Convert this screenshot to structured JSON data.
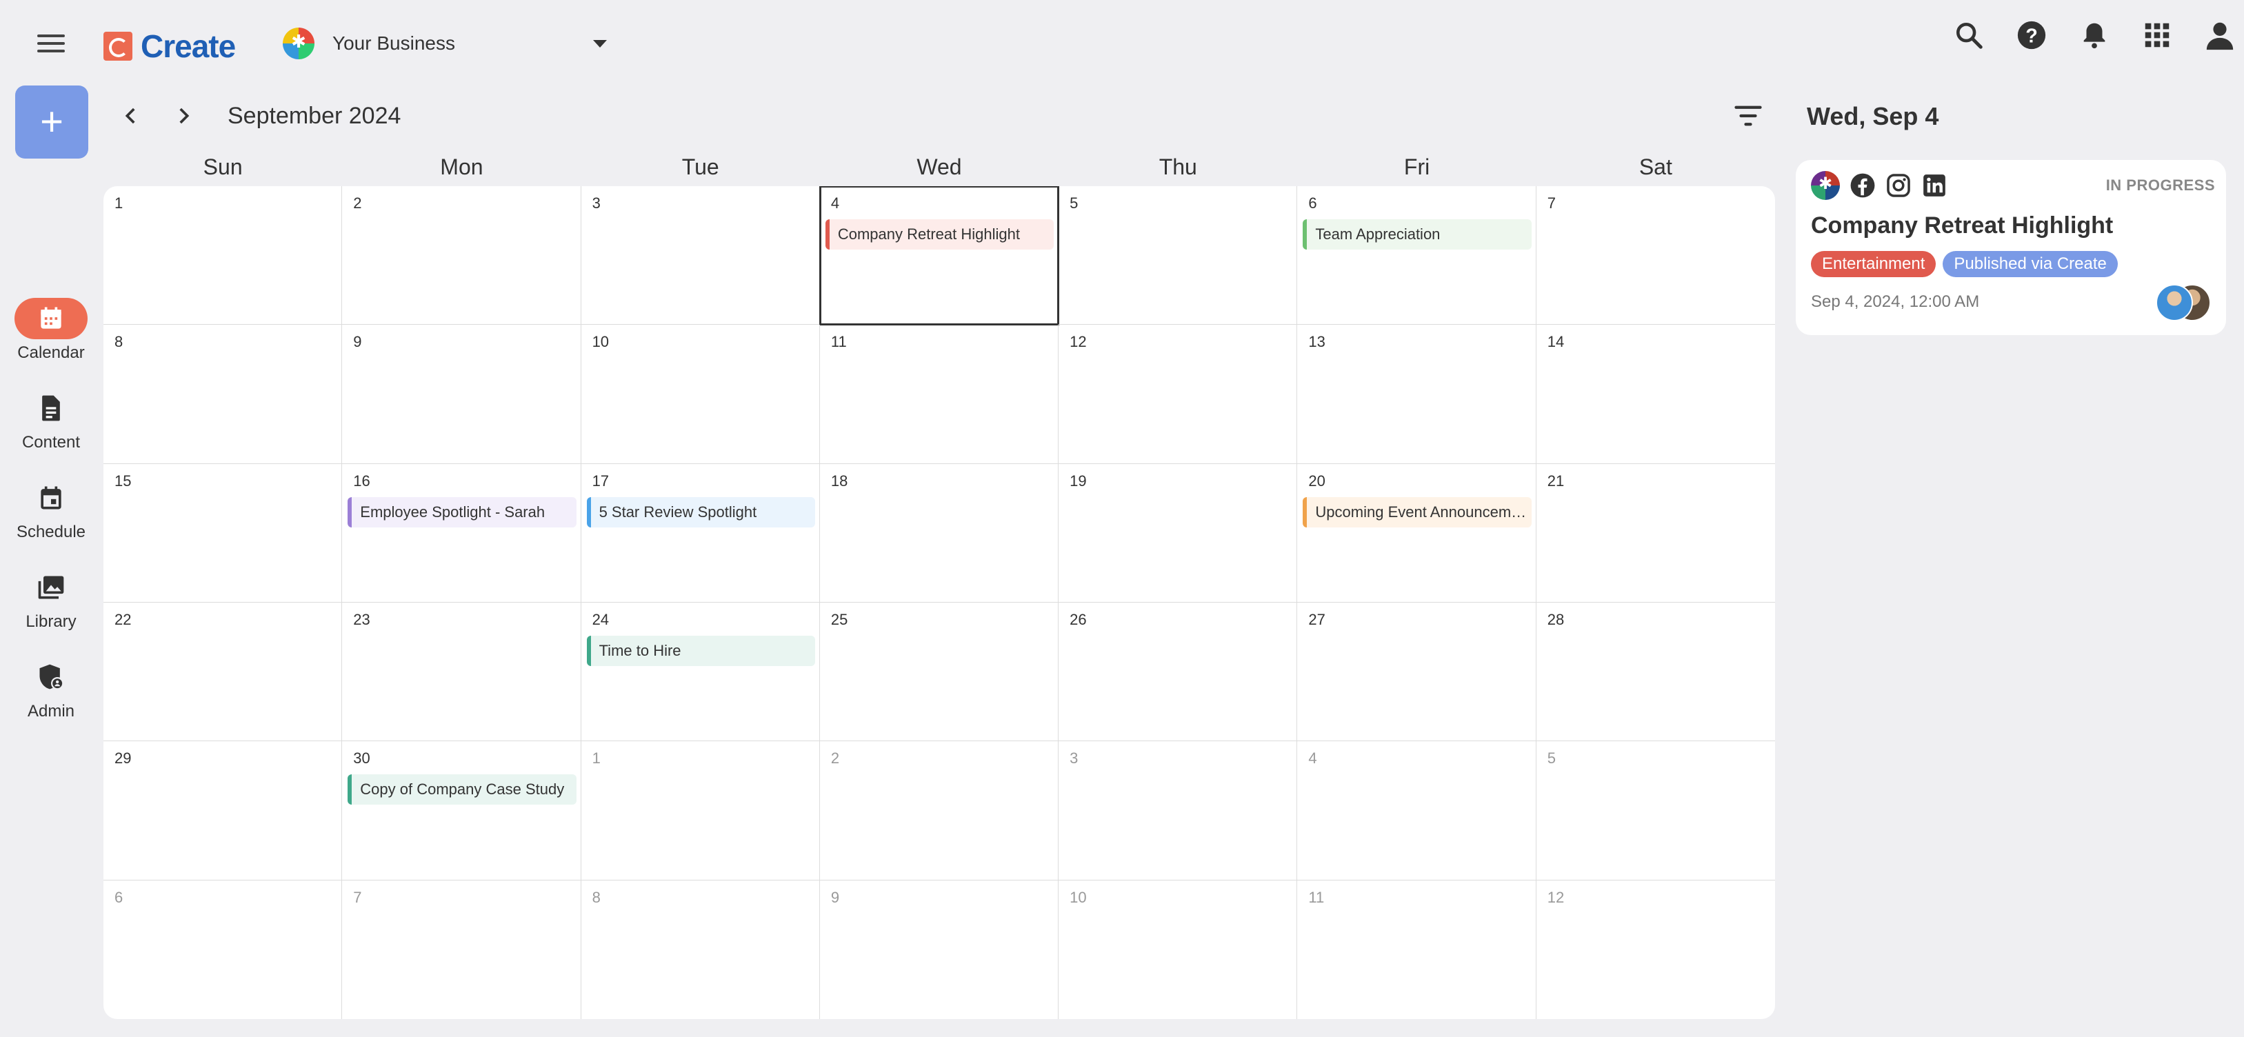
{
  "app": {
    "name": "Create",
    "business": "Your Business"
  },
  "nav": [
    {
      "label": "Calendar",
      "icon": "calendar-icon",
      "active": true
    },
    {
      "label": "Content",
      "icon": "document-icon",
      "active": false
    },
    {
      "label": "Schedule",
      "icon": "schedule-icon",
      "active": false
    },
    {
      "label": "Library",
      "icon": "library-icon",
      "active": false
    },
    {
      "label": "Admin",
      "icon": "admin-shield-icon",
      "active": false
    }
  ],
  "fab_label": "+",
  "calendar": {
    "title": "September 2024",
    "weekdays": [
      "Sun",
      "Mon",
      "Tue",
      "Wed",
      "Thu",
      "Fri",
      "Sat"
    ],
    "days": [
      {
        "n": "1",
        "m": false
      },
      {
        "n": "2",
        "m": false
      },
      {
        "n": "3",
        "m": false
      },
      {
        "n": "4",
        "m": false,
        "selected": true
      },
      {
        "n": "5",
        "m": false
      },
      {
        "n": "6",
        "m": false
      },
      {
        "n": "7",
        "m": false
      },
      {
        "n": "8",
        "m": false
      },
      {
        "n": "9",
        "m": false
      },
      {
        "n": "10",
        "m": false
      },
      {
        "n": "11",
        "m": false
      },
      {
        "n": "12",
        "m": false
      },
      {
        "n": "13",
        "m": false
      },
      {
        "n": "14",
        "m": false
      },
      {
        "n": "15",
        "m": false
      },
      {
        "n": "16",
        "m": false
      },
      {
        "n": "17",
        "m": false
      },
      {
        "n": "18",
        "m": false
      },
      {
        "n": "19",
        "m": false
      },
      {
        "n": "20",
        "m": false
      },
      {
        "n": "21",
        "m": false
      },
      {
        "n": "22",
        "m": false
      },
      {
        "n": "23",
        "m": false
      },
      {
        "n": "24",
        "m": false
      },
      {
        "n": "25",
        "m": false
      },
      {
        "n": "26",
        "m": false
      },
      {
        "n": "27",
        "m": false
      },
      {
        "n": "28",
        "m": false
      },
      {
        "n": "29",
        "m": false
      },
      {
        "n": "30",
        "m": false
      },
      {
        "n": "1",
        "m": true
      },
      {
        "n": "2",
        "m": true
      },
      {
        "n": "3",
        "m": true
      },
      {
        "n": "4",
        "m": true
      },
      {
        "n": "5",
        "m": true
      },
      {
        "n": "6",
        "m": true
      },
      {
        "n": "7",
        "m": true
      },
      {
        "n": "8",
        "m": true
      },
      {
        "n": "9",
        "m": true
      },
      {
        "n": "10",
        "m": true
      },
      {
        "n": "11",
        "m": true
      },
      {
        "n": "12",
        "m": true
      }
    ],
    "events": [
      {
        "cell": 3,
        "title": "Company Retreat Highlight",
        "bar": "#e05a4e",
        "bg": "#fdecea"
      },
      {
        "cell": 5,
        "title": "Team Appreciation",
        "bar": "#6cc070",
        "bg": "#eef7ee"
      },
      {
        "cell": 15,
        "title": "Employee Spotlight - Sarah",
        "bar": "#9b7fd6",
        "bg": "#f3effb"
      },
      {
        "cell": 16,
        "title": "5 Star Review Spotlight",
        "bar": "#4aa3e8",
        "bg": "#eaf4fd"
      },
      {
        "cell": 19,
        "title": "Upcoming Event Announceme...",
        "bar": "#f0a24a",
        "bg": "#fef3e7"
      },
      {
        "cell": 23,
        "title": "Time to Hire",
        "bar": "#3fa88a",
        "bg": "#e9f5f1"
      },
      {
        "cell": 29,
        "title": "Copy of Company Case Study",
        "bar": "#3fa88a",
        "bg": "#e9f5f1"
      }
    ]
  },
  "panel": {
    "date_title": "Wed, Sep 4",
    "card": {
      "status": "IN PROGRESS",
      "title": "Company Retreat Highlight",
      "tags": [
        {
          "label": "Entertainment",
          "color": "#e05a4e"
        },
        {
          "label": "Published via Create",
          "color": "#7a9ae6"
        }
      ],
      "datetime": "Sep 4, 2024, 12:00 AM",
      "networks": [
        "facebook-icon",
        "instagram-icon",
        "linkedin-icon"
      ]
    }
  }
}
